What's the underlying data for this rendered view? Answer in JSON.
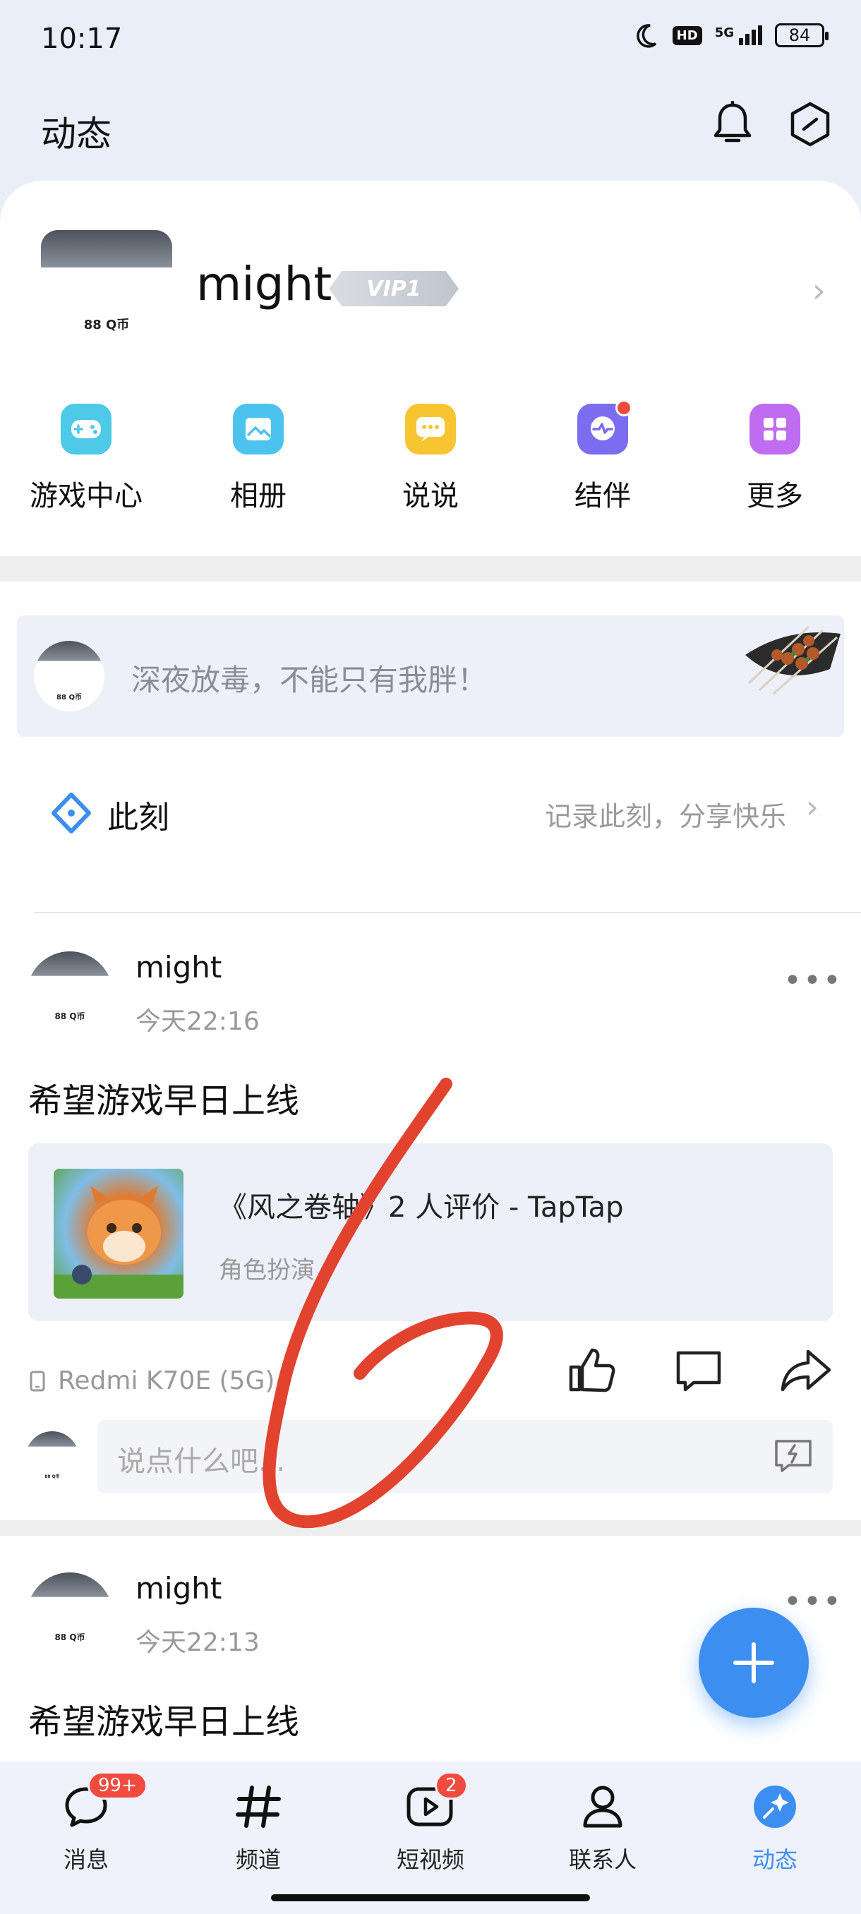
{
  "status_bar": {
    "time": "10:17",
    "hd": "HD",
    "network": "5G",
    "battery": "84"
  },
  "header": {
    "title": "动态"
  },
  "profile": {
    "name": "might",
    "vip": "VIP1",
    "avatar_coin": "88 Q币"
  },
  "quick_actions": [
    {
      "label": "游戏中心",
      "icon": "gamepad-icon",
      "color": "#4ec9e8"
    },
    {
      "label": "相册",
      "icon": "photo-album-icon",
      "color": "#4cc3ee"
    },
    {
      "label": "说说",
      "icon": "chat-bubble-icon",
      "color": "#f7c432"
    },
    {
      "label": "结伴",
      "icon": "companion-icon",
      "color": "#7b6cf0"
    },
    {
      "label": "更多",
      "icon": "grid-icon",
      "color": "#c06cf0"
    }
  ],
  "mood_banner": {
    "text": "深夜放毒，不能只有我胖！"
  },
  "moment": {
    "title": "此刻",
    "hint": "记录此刻，分享快乐"
  },
  "posts": [
    {
      "author": "might",
      "time": "今天22:16",
      "text": "希望游戏早日上线",
      "share": {
        "title": "《风之卷轴》2 人评价 - TapTap",
        "subtitle": "角色扮演"
      },
      "device": "Redmi K70E (5G)",
      "comment_placeholder": "说点什么吧..."
    },
    {
      "author": "might",
      "time": "今天22:13",
      "text": "希望游戏早日上线"
    }
  ],
  "bottom_nav": [
    {
      "label": "消息",
      "icon": "message-icon",
      "badge": "99+"
    },
    {
      "label": "频道",
      "icon": "hashtag-icon",
      "badge": ""
    },
    {
      "label": "短视频",
      "icon": "video-icon",
      "badge": "2"
    },
    {
      "label": "联系人",
      "icon": "contacts-icon",
      "badge": ""
    },
    {
      "label": "动态",
      "icon": "feed-icon",
      "badge": "",
      "active": true
    }
  ],
  "colors": {
    "accent": "#3c8ef0",
    "badge": "#f04b3e",
    "annotation": "#e2432f"
  }
}
